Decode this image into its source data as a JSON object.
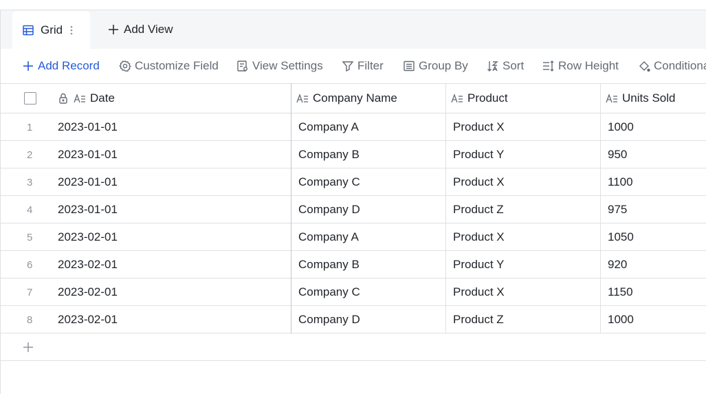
{
  "tabs": {
    "active_label": "Grid",
    "add_view_label": "Add View"
  },
  "toolbar": {
    "add_record": "Add Record",
    "customize_field": "Customize Field",
    "view_settings": "View Settings",
    "filter": "Filter",
    "group_by": "Group By",
    "sort": "Sort",
    "row_height": "Row Height",
    "conditional": "Conditional"
  },
  "columns": [
    "Date",
    "Company Name",
    "Product",
    "Units Sold"
  ],
  "rows": [
    {
      "num": "1",
      "date": "2023-01-01",
      "company": "Company A",
      "product": "Product X",
      "units": "1000"
    },
    {
      "num": "2",
      "date": "2023-01-01",
      "company": "Company B",
      "product": "Product Y",
      "units": "950"
    },
    {
      "num": "3",
      "date": "2023-01-01",
      "company": "Company C",
      "product": "Product X",
      "units": "1100"
    },
    {
      "num": "4",
      "date": "2023-01-01",
      "company": "Company D",
      "product": "Product Z",
      "units": "975"
    },
    {
      "num": "5",
      "date": "2023-02-01",
      "company": "Company A",
      "product": "Product X",
      "units": "1050"
    },
    {
      "num": "6",
      "date": "2023-02-01",
      "company": "Company B",
      "product": "Product Y",
      "units": "920"
    },
    {
      "num": "7",
      "date": "2023-02-01",
      "company": "Company C",
      "product": "Product X",
      "units": "1150"
    },
    {
      "num": "8",
      "date": "2023-02-01",
      "company": "Company D",
      "product": "Product Z",
      "units": "1000"
    }
  ],
  "colors": {
    "accent": "#245bdb",
    "text": "#1f2329",
    "muted": "#646a73",
    "border": "#dee0e3"
  }
}
